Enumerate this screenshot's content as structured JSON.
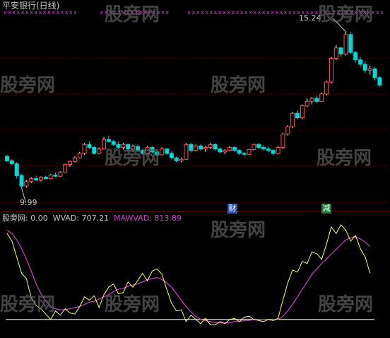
{
  "main_chart": {
    "title": "平安银行(日线)",
    "high_label": "15.24",
    "low_label": "9.99",
    "event_tags": [
      "财",
      "减"
    ],
    "colors": {
      "up": "#ff5050",
      "down": "#00d8d8",
      "marker": "#d040d0",
      "grid": "#8b0000",
      "wick_up": "#ffffff"
    }
  },
  "indicator": {
    "name": "股旁网",
    "value": ": 0.00",
    "wvad_text": "WVAD: 707.21",
    "mawvad_text": "MAWVAD: 813.89",
    "colors": {
      "wvad": "#ffff80",
      "mawvad": "#d040d0",
      "baseline": "#ffffff"
    }
  },
  "watermark": "股旁网",
  "chart_data": {
    "type": "candlestick",
    "ylim": [
      9.6,
      15.6
    ],
    "candles": [
      [
        11.05,
        11.1,
        10.85,
        10.9
      ],
      [
        10.9,
        10.95,
        10.75,
        10.8
      ],
      [
        10.8,
        10.85,
        10.3,
        10.4
      ],
      [
        10.4,
        10.45,
        9.99,
        10.05
      ],
      [
        10.05,
        10.25,
        10.0,
        10.2
      ],
      [
        10.2,
        10.35,
        10.15,
        10.3
      ],
      [
        10.3,
        10.4,
        10.22,
        10.25
      ],
      [
        10.25,
        10.38,
        10.2,
        10.35
      ],
      [
        10.35,
        10.4,
        10.28,
        10.3
      ],
      [
        10.3,
        10.45,
        10.28,
        10.42
      ],
      [
        10.42,
        10.5,
        10.35,
        10.38
      ],
      [
        10.38,
        10.55,
        10.36,
        10.52
      ],
      [
        10.52,
        10.8,
        10.5,
        10.78
      ],
      [
        10.78,
        10.9,
        10.7,
        10.88
      ],
      [
        10.88,
        11.05,
        10.85,
        11.0
      ],
      [
        11.0,
        11.2,
        10.98,
        11.15
      ],
      [
        11.15,
        11.5,
        11.1,
        11.45
      ],
      [
        11.45,
        11.55,
        11.3,
        11.35
      ],
      [
        11.35,
        11.4,
        11.1,
        11.15
      ],
      [
        11.15,
        11.35,
        11.12,
        11.3
      ],
      [
        11.3,
        11.7,
        11.28,
        11.62
      ],
      [
        11.62,
        11.75,
        11.5,
        11.55
      ],
      [
        11.55,
        11.6,
        11.4,
        11.45
      ],
      [
        11.45,
        11.55,
        11.3,
        11.35
      ],
      [
        11.35,
        11.5,
        11.28,
        11.45
      ],
      [
        11.45,
        11.48,
        11.25,
        11.3
      ],
      [
        11.3,
        11.45,
        11.2,
        11.38
      ],
      [
        11.38,
        11.45,
        11.2,
        11.25
      ],
      [
        11.25,
        11.3,
        11.1,
        11.15
      ],
      [
        11.15,
        11.4,
        11.12,
        11.35
      ],
      [
        11.35,
        11.38,
        11.15,
        11.2
      ],
      [
        11.2,
        11.25,
        11.05,
        11.1
      ],
      [
        11.1,
        11.35,
        11.08,
        11.3
      ],
      [
        11.3,
        11.32,
        11.1,
        11.15
      ],
      [
        11.15,
        11.22,
        10.95,
        11.0
      ],
      [
        11.0,
        11.05,
        10.85,
        10.9
      ],
      [
        10.9,
        11.0,
        10.85,
        10.95
      ],
      [
        10.95,
        11.5,
        10.93,
        11.45
      ],
      [
        11.45,
        11.5,
        11.2,
        11.25
      ],
      [
        11.25,
        11.45,
        11.22,
        11.4
      ],
      [
        11.4,
        11.45,
        11.25,
        11.3
      ],
      [
        11.3,
        11.4,
        11.2,
        11.35
      ],
      [
        11.35,
        11.5,
        11.3,
        11.45
      ],
      [
        11.45,
        11.48,
        11.25,
        11.3
      ],
      [
        11.3,
        11.35,
        11.15,
        11.2
      ],
      [
        11.2,
        11.3,
        11.12,
        11.25
      ],
      [
        11.25,
        11.4,
        11.22,
        11.35
      ],
      [
        11.35,
        11.4,
        11.2,
        11.25
      ],
      [
        11.25,
        11.3,
        11.1,
        11.15
      ],
      [
        11.15,
        11.2,
        11.05,
        11.12
      ],
      [
        11.12,
        11.3,
        11.1,
        11.28
      ],
      [
        11.28,
        11.48,
        11.25,
        11.45
      ],
      [
        11.45,
        11.5,
        11.3,
        11.35
      ],
      [
        11.35,
        11.42,
        11.25,
        11.3
      ],
      [
        11.3,
        11.38,
        11.2,
        11.25
      ],
      [
        11.25,
        11.3,
        11.1,
        11.15
      ],
      [
        11.15,
        11.4,
        11.12,
        11.35
      ],
      [
        11.35,
        11.85,
        11.3,
        11.8
      ],
      [
        11.8,
        12.1,
        11.75,
        12.05
      ],
      [
        12.05,
        12.55,
        12.0,
        12.5
      ],
      [
        12.5,
        12.6,
        12.3,
        12.35
      ],
      [
        12.35,
        12.8,
        12.3,
        12.75
      ],
      [
        12.75,
        13.0,
        12.7,
        12.9
      ],
      [
        12.9,
        13.05,
        12.8,
        13.0
      ],
      [
        13.0,
        13.1,
        12.85,
        12.9
      ],
      [
        12.9,
        13.2,
        12.88,
        13.15
      ],
      [
        13.15,
        13.6,
        13.1,
        13.55
      ],
      [
        13.55,
        14.4,
        13.5,
        14.35
      ],
      [
        14.35,
        14.8,
        14.3,
        14.7
      ],
      [
        14.7,
        14.75,
        14.4,
        14.5
      ],
      [
        14.5,
        15.24,
        14.45,
        15.15
      ],
      [
        15.15,
        15.24,
        14.5,
        14.55
      ],
      [
        14.55,
        14.6,
        14.2,
        14.3
      ],
      [
        14.3,
        14.4,
        14.05,
        14.15
      ],
      [
        14.15,
        14.25,
        13.85,
        13.95
      ],
      [
        13.95,
        14.1,
        13.8,
        14.0
      ],
      [
        14.0,
        14.05,
        13.6,
        13.7
      ],
      [
        13.7,
        13.75,
        13.4,
        13.45
      ]
    ],
    "wvad": [
      0.92,
      0.85,
      0.7,
      0.55,
      0.5,
      0.32,
      0.25,
      0.22,
      0.17,
      0.12,
      0.2,
      0.16,
      0.22,
      0.18,
      0.17,
      0.24,
      0.33,
      0.3,
      0.34,
      0.23,
      0.35,
      0.42,
      0.45,
      0.36,
      0.37,
      0.47,
      0.42,
      0.48,
      0.55,
      0.48,
      0.57,
      0.59,
      0.54,
      0.4,
      0.27,
      0.2,
      0.21,
      0.1,
      0.16,
      0.12,
      0.08,
      0.13,
      0.07,
      0.07,
      0.1,
      0.08,
      0.12,
      0.13,
      0.1,
      0.14,
      0.15,
      0.12,
      0.11,
      0.1,
      0.12,
      0.11,
      0.13,
      0.3,
      0.46,
      0.58,
      0.56,
      0.66,
      0.64,
      0.75,
      0.73,
      0.68,
      0.82,
      0.98,
      0.92,
      1.0,
      0.95,
      0.85,
      0.9,
      0.78,
      0.7,
      0.55
    ],
    "mawvad": [
      0.95,
      0.92,
      0.86,
      0.78,
      0.68,
      0.57,
      0.45,
      0.36,
      0.29,
      0.24,
      0.22,
      0.21,
      0.21,
      0.22,
      0.23,
      0.24,
      0.26,
      0.28,
      0.29,
      0.31,
      0.33,
      0.35,
      0.38,
      0.4,
      0.41,
      0.43,
      0.44,
      0.45,
      0.47,
      0.49,
      0.5,
      0.51,
      0.49,
      0.46,
      0.42,
      0.36,
      0.3,
      0.24,
      0.19,
      0.15,
      0.12,
      0.11,
      0.1,
      0.09,
      0.09,
      0.09,
      0.09,
      0.1,
      0.1,
      0.11,
      0.11,
      0.12,
      0.12,
      0.12,
      0.12,
      0.12,
      0.12,
      0.15,
      0.2,
      0.26,
      0.33,
      0.4,
      0.47,
      0.54,
      0.59,
      0.64,
      0.68,
      0.73,
      0.77,
      0.82,
      0.86,
      0.88,
      0.89,
      0.87,
      0.84,
      0.8
    ],
    "baseline_level": 0.12
  }
}
